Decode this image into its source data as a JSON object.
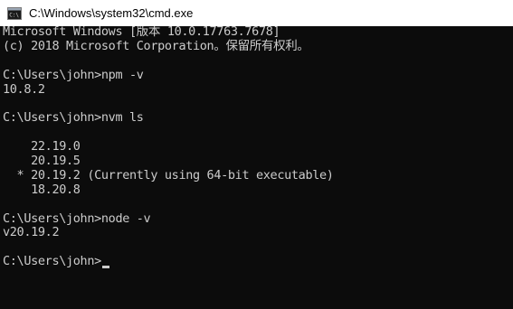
{
  "window": {
    "title": "C:\\Windows\\system32\\cmd.exe",
    "icon": "cmd-icon"
  },
  "console": {
    "lines": [
      "Microsoft Windows [版本 10.0.17763.7678]",
      "(c) 2018 Microsoft Corporation。保留所有权利。",
      "",
      "C:\\Users\\john>npm -v",
      "10.8.2",
      "",
      "C:\\Users\\john>nvm ls",
      "",
      "    22.19.0",
      "    20.19.5",
      "  * 20.19.2 (Currently using 64-bit executable)",
      "    18.20.8",
      "",
      "C:\\Users\\john>node -v",
      "v20.19.2",
      ""
    ],
    "prompt": "C:\\Users\\john>"
  }
}
